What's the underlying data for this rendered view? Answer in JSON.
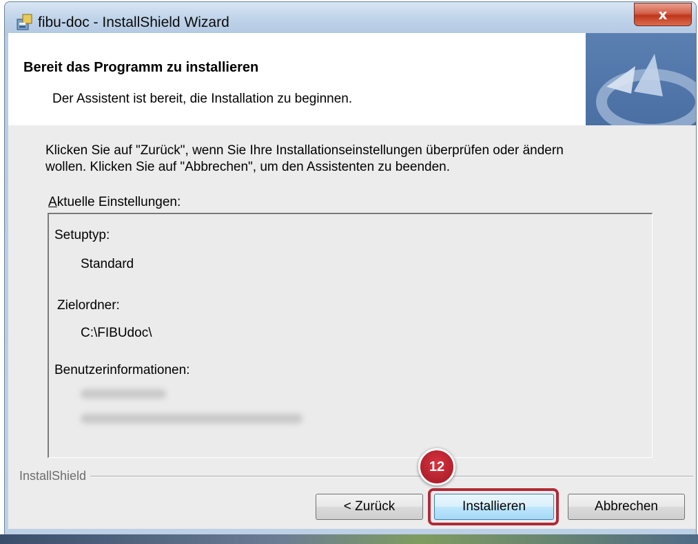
{
  "window": {
    "title": "fibu-doc - InstallShield Wizard",
    "close_label": "x"
  },
  "header": {
    "title": "Bereit das Programm zu installieren",
    "subtitle": "Der Assistent ist bereit, die Installation zu beginnen."
  },
  "content": {
    "intro_line1": "Klicken Sie auf \"Zurück\", wenn Sie Ihre Installationseinstellungen überprüfen oder ändern",
    "intro_line2": "wollen. Klicken Sie auf \"Abbrechen\", um den Assistenten zu beenden.",
    "settings_label_accel": "A",
    "settings_label_rest": "ktuelle Einstellungen:",
    "settings": {
      "setup_type_label": "Setuptyp:",
      "setup_type_value": "Standard",
      "dest_folder_label": "Zielordner:",
      "dest_folder_value": "C:\\FIBUdoc\\",
      "user_info_label": "Benutzerinformationen:"
    }
  },
  "footer": {
    "brand": "InstallShield",
    "back_button": "< Zurück",
    "install_button": "Installieren",
    "cancel_button": "Abbrechen"
  },
  "annotation": {
    "step_number": "12"
  },
  "colors": {
    "highlight": "#b02a36",
    "badge": "#c22a36",
    "header_logo": "#4a6fa3",
    "close_button": "#c1351c"
  }
}
